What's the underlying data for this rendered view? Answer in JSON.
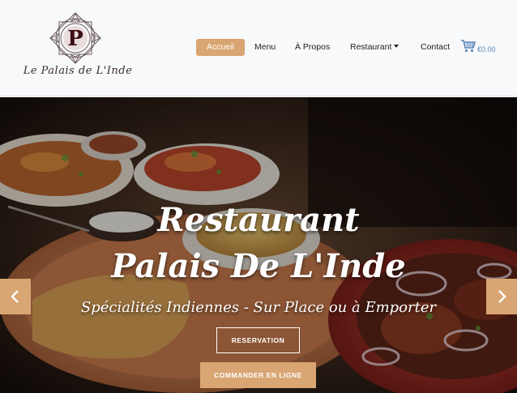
{
  "brand": {
    "logo_text": "Le Palais de L'Inde",
    "logo_letter": "P"
  },
  "nav": {
    "items": [
      {
        "label": "Accueil",
        "active": true
      },
      {
        "label": "Menu"
      },
      {
        "label": "À Propos"
      },
      {
        "label": "Restaurant",
        "dropdown": true
      },
      {
        "label": "Contact"
      }
    ],
    "cart_total": "€0.00",
    "cart_icon": "shopping-cart-icon"
  },
  "hero": {
    "title_line1": "Restaurant",
    "title_line2": "Palais De L'Inde",
    "subtitle": "Spécialités Indiennes - Sur Place ou à Emporter",
    "reservation_label": "RESERVATION",
    "order_label": "COMMANDER EN LIGNE",
    "prev_icon": "chevron-left-icon",
    "next_icon": "chevron-right-icon"
  },
  "colors": {
    "accent": "#d9a572",
    "header_bg": "#f8f9fb",
    "cart": "#5a86b8",
    "text": "#222222"
  }
}
